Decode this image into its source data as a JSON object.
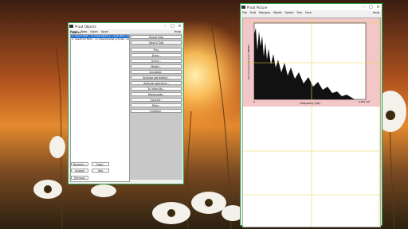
{
  "colors": {
    "window_border_active": "#2aa34a",
    "selected_item": "#1f6fd6",
    "pink_selection": "#f3c6c8",
    "spectrum_fill": "#111111",
    "viewport_outline": "#e8d84a"
  },
  "objects_window": {
    "title": "Praat Objects",
    "menu": [
      "Praat",
      "New",
      "Open",
      "Save"
    ],
    "help": "Help",
    "list_label": "Objects:",
    "items": [
      {
        "label": "1. Sound Butt... (C:/Users/Name/.../cello.flac) (1)",
        "selected": true
      },
      {
        "label": "2. Spectrum Butt... (C:/Users/Cellist_scholat...(Larry_Slots)",
        "selected": false
      }
    ],
    "actions": [
      "Sound help",
      "View & Edit",
      "Play",
      "Draw -",
      "Query -",
      "Modify -",
      "Annotate -",
      "Analyse periodicity -",
      "Analyse spectrum -",
      "To Intensity...",
      "Manipulate -",
      "Convert -",
      "Filter -",
      "Combine -"
    ],
    "bottom_buttons": {
      "rename": "Rename...",
      "copy": "Copy...",
      "inspect": "Inspect",
      "info": "Info",
      "remove": "Remove"
    }
  },
  "picture_window": {
    "title": "Praat Picture",
    "menu": [
      "File",
      "Edit",
      "Margins",
      "World",
      "Select",
      "Pen",
      "Font"
    ],
    "help": "Help",
    "chart": {
      "ylabel": "Sound pressure level (dB/Hz)",
      "xlabel": "Frequency (Hz)",
      "x_tick_label": "2.205 10⁴",
      "x_tick_left": "0"
    }
  }
}
